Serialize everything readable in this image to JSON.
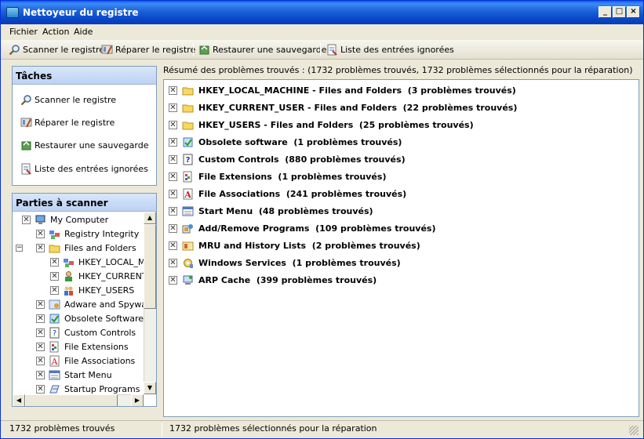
{
  "window": {
    "title": "Nettoyeur du registre",
    "minimize": "_",
    "maximize": "□",
    "close": "×"
  },
  "menu": [
    "Fichier",
    "Action",
    "Aide"
  ],
  "toolbar": {
    "scan": "Scanner le registre",
    "repair": "Réparer le registre",
    "restore": "Restaurer une sauvegarde",
    "ignored": "Liste des entrées ignorées"
  },
  "tasks": {
    "title": "Tâches",
    "items": [
      "Scanner le registre",
      "Réparer le registre",
      "Restaurer une sauvegarde",
      "Liste des entrées ignorées"
    ]
  },
  "tree": {
    "title": "Parties à scanner",
    "items": [
      {
        "label": "My Computer",
        "icon": "computer-icon"
      },
      {
        "label": "Registry Integrity",
        "icon": "registry-icon"
      },
      {
        "label": "Files and Folders",
        "icon": "folder-icon"
      },
      {
        "label": "HKEY_LOCAL_MAC",
        "icon": "local-machine-icon"
      },
      {
        "label": "HKEY_CURRENT_U",
        "icon": "current-user-icon"
      },
      {
        "label": "HKEY_USERS",
        "icon": "users-icon"
      },
      {
        "label": "Adware and Spyware",
        "icon": "adware-icon"
      },
      {
        "label": "Obsolete Software",
        "icon": "software-icon"
      },
      {
        "label": "Custom Controls",
        "icon": "help-icon"
      },
      {
        "label": "File Extensions",
        "icon": "file-extensions-icon"
      },
      {
        "label": "File Associations",
        "icon": "file-associations-icon"
      },
      {
        "label": "Start Menu",
        "icon": "start-menu-icon"
      },
      {
        "label": "Startup Programs",
        "icon": "startup-icon"
      }
    ]
  },
  "summary": "Résumé des problèmes trouvés : (1732 problèmes trouvés, 1732 problèmes sélectionnés pour la réparation)",
  "results": [
    {
      "label": "HKEY_LOCAL_MACHINE - Files and Folders  (3 problèmes trouvés)",
      "icon": "folder-icon"
    },
    {
      "label": "HKEY_CURRENT_USER - Files and Folders  (22 problèmes trouvés)",
      "icon": "folder-icon"
    },
    {
      "label": "HKEY_USERS - Files and Folders  (25 problèmes trouvés)",
      "icon": "folder-icon"
    },
    {
      "label": "Obsolete software  (1 problèmes trouvés)",
      "icon": "software-icon"
    },
    {
      "label": "Custom Controls  (880 problèmes trouvés)",
      "icon": "help-icon"
    },
    {
      "label": "File Extensions  (1 problèmes trouvés)",
      "icon": "file-extensions-icon"
    },
    {
      "label": "File Associations  (241 problèmes trouvés)",
      "icon": "file-associations-icon"
    },
    {
      "label": "Start Menu  (48 problèmes trouvés)",
      "icon": "start-menu-icon"
    },
    {
      "label": "Add/Remove Programs  (109 problèmes trouvés)",
      "icon": "add-remove-icon"
    },
    {
      "label": "MRU and History Lists  (2 problèmes trouvés)",
      "icon": "history-icon"
    },
    {
      "label": "Windows Services  (1 problèmes trouvés)",
      "icon": "services-icon"
    },
    {
      "label": "ARP Cache  (399 problèmes trouvés)",
      "icon": "arp-cache-icon"
    }
  ],
  "status": {
    "found": "1732 problèmes trouvés",
    "selected": "1732 problèmes sélectionnés pour la réparation"
  },
  "checkmark": "✕",
  "expander": "−"
}
